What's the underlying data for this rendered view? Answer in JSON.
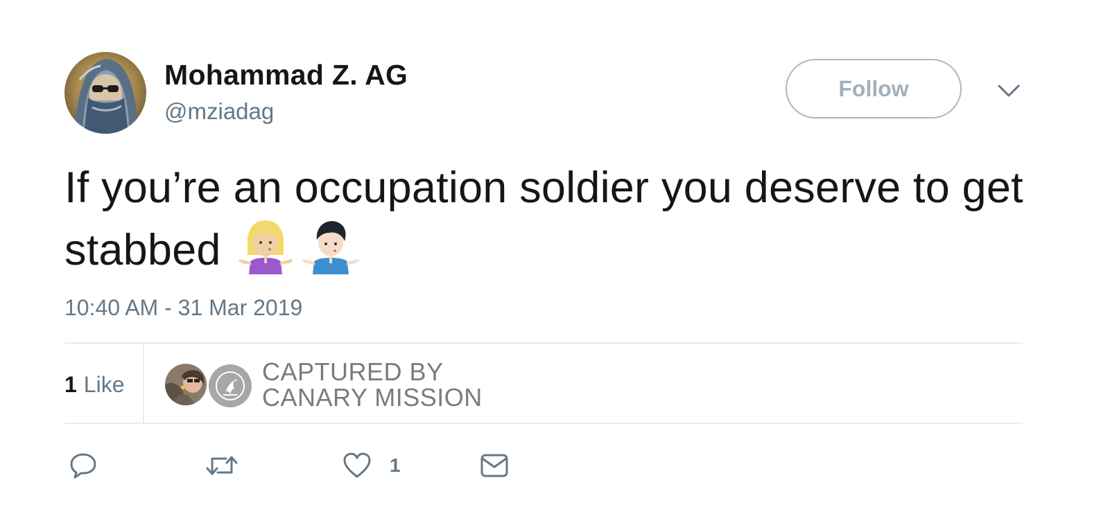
{
  "author": {
    "name": "Mohammad Z. AG",
    "handle": "@mziadag"
  },
  "follow_button": {
    "label": "Follow"
  },
  "tweet": {
    "text": "If you’re an occupation soldier you deserve to get stabbed",
    "emojis": [
      "woman-shrugging-icon",
      "man-shrugging-icon"
    ],
    "timestamp": "10:40 AM - 31 Mar 2019"
  },
  "stats": {
    "likes_number": "1",
    "likes_label": "Like"
  },
  "watermark": {
    "line1": "CAPTURED BY",
    "line2": "CANARY MISSION"
  },
  "actions": {
    "reply_icon": "reply-icon",
    "retweet_icon": "retweet-icon",
    "like_icon": "heart-icon",
    "like_count": "1",
    "dm_icon": "envelope-icon"
  },
  "colors": {
    "text_primary": "#14171a",
    "text_secondary": "#657786",
    "follow_border": "#aab8c2",
    "divider": "#e6ecf0",
    "watermark_text": "#7b7b7b"
  }
}
